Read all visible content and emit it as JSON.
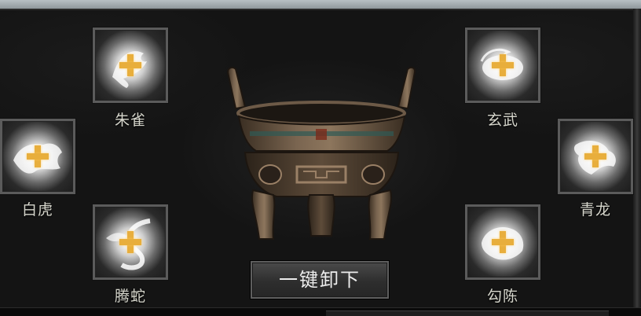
{
  "slots": [
    {
      "id": "zhuque",
      "label": "朱雀",
      "icon": "vermilion-bird-icon"
    },
    {
      "id": "xuanwu",
      "label": "玄武",
      "icon": "black-tortoise-icon"
    },
    {
      "id": "baihu",
      "label": "白虎",
      "icon": "white-tiger-icon"
    },
    {
      "id": "qinglong",
      "label": "青龙",
      "icon": "azure-dragon-icon"
    },
    {
      "id": "tengshe",
      "label": "腾蛇",
      "icon": "soaring-serpent-icon"
    },
    {
      "id": "gouchen",
      "label": "勾陈",
      "icon": "gouchen-icon"
    }
  ],
  "cauldron": {
    "icon": "bronze-ding-cauldron-icon"
  },
  "unequip_button": {
    "label": "一键卸下"
  },
  "colors": {
    "slot_plus": "#e8ae3c",
    "label_text": "#d6d6cc",
    "panel_bg": "#141414"
  }
}
